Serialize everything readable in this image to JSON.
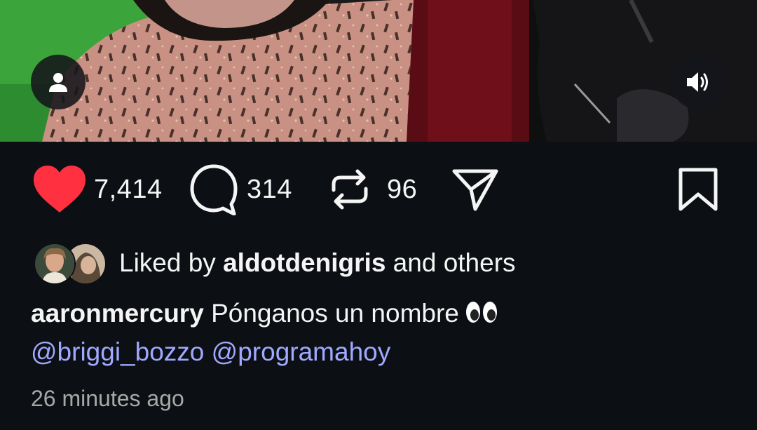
{
  "post": {
    "media": {
      "tag_icon": "person-icon",
      "sound_icon": "speaker-icon"
    },
    "actions": {
      "likes": "7,414",
      "comments": "314",
      "reposts": "96",
      "like_icon": "heart-filled-icon",
      "comment_icon": "comment-bubble-icon",
      "repost_icon": "repost-icon",
      "share_icon": "send-icon",
      "save_icon": "bookmark-icon",
      "like_color": "#ff3040"
    },
    "liked_by": {
      "prefix": "Liked by ",
      "user": "aldotdenigris",
      "suffix": " and others"
    },
    "caption": {
      "username": "aaronmercury",
      "text": " Pónganos un nombre",
      "emoji": "eyes-emoji",
      "mentions": [
        "@briggi_bozzo",
        "@programahoy"
      ]
    },
    "timestamp": "26 minutes ago",
    "colors": {
      "background": "#0c1014",
      "mention": "#a0a8ff",
      "muted": "#a8a8a8"
    }
  }
}
